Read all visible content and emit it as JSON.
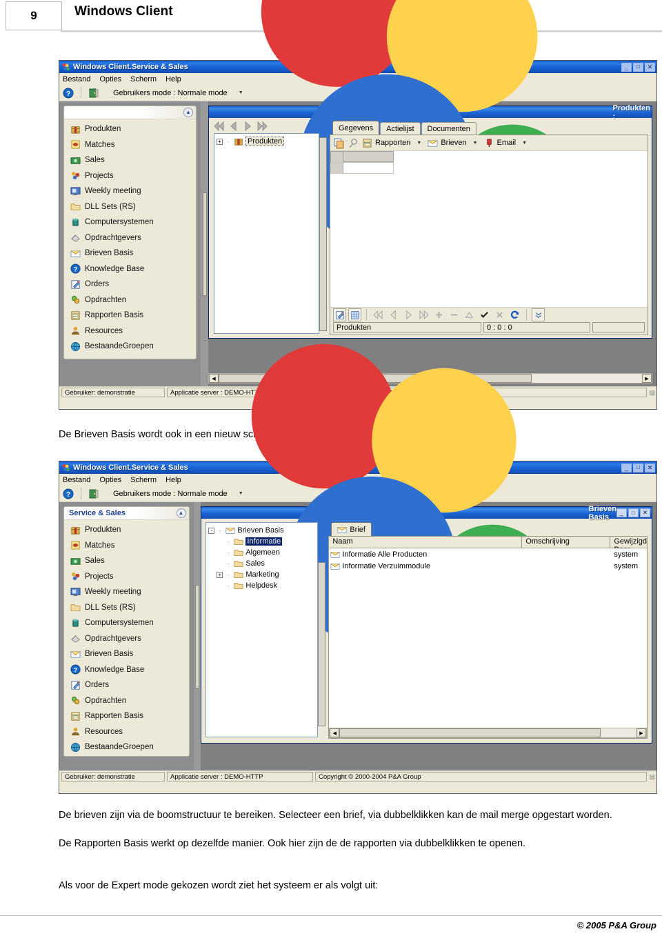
{
  "page": {
    "number": "9",
    "header_title": "Windows Client",
    "footer": "© 2005 P&A Group"
  },
  "paragraphs": {
    "between_screens": "De Brieven Basis wordt ook in een nieuw scherm geopend.",
    "p1": "De brieven zijn via de boomstructuur te bereiken. Selecteer een brief, via dubbelklikken kan de mail merge opgestart worden.",
    "p2": "De Rapporten Basis werkt op dezelfde manier. Ook hier zijn de de rapporten via dubbelklikken te openen.",
    "p3": "Als voor de Expert mode gekozen wordt ziet het systeem er als volgt uit:"
  },
  "app": {
    "title": "Windows Client.Service & Sales",
    "menus": [
      "Bestand",
      "Opties",
      "Scherm",
      "Help"
    ],
    "toolbar": {
      "help_icon": "help-question-icon",
      "exit_icon": "exit-door-icon",
      "mode_label": "Gebruikers mode : Normale mode",
      "caret": "▼"
    },
    "window_buttons": {
      "minimize": "_",
      "maximize": "□",
      "close": "✕"
    },
    "statusbar": {
      "user": "Gebruiker: demonstratie",
      "server": "Applicatie server : DEMO-HTTP",
      "copyright": "Copyright © 2000-2004 P&A Group"
    }
  },
  "nav": {
    "header_blank": "",
    "header_title": "Service & Sales",
    "collapse_icon": "chevron-up-icon",
    "items": [
      {
        "label": "Produkten",
        "icon": "gift-box-icon"
      },
      {
        "label": "Matches",
        "icon": "yellow-match-icon"
      },
      {
        "label": "Sales",
        "icon": "money-icon"
      },
      {
        "label": "Projects",
        "icon": "projects-icon"
      },
      {
        "label": "Weekly meeting",
        "icon": "meeting-icon"
      },
      {
        "label": "DLL Sets (RS)",
        "icon": "folder-icon"
      },
      {
        "label": "Computersystemen",
        "icon": "database-icon"
      },
      {
        "label": "Opdrachtgevers",
        "icon": "clients-icon"
      },
      {
        "label": "Brieven Basis",
        "icon": "envelope-icon"
      },
      {
        "label": "Knowledge Base",
        "icon": "help-question-icon"
      },
      {
        "label": "Orders",
        "icon": "edit-note-icon"
      },
      {
        "label": "Opdrachten",
        "icon": "tasks-icon"
      },
      {
        "label": "Rapporten Basis",
        "icon": "report-icon"
      },
      {
        "label": "Resources",
        "icon": "person-icon"
      },
      {
        "label": "BestaandeGroepen",
        "icon": "globe-icon"
      }
    ]
  },
  "produkten_window": {
    "title": "Produkten :",
    "nav_arrows": [
      "first",
      "previous",
      "next",
      "last"
    ],
    "tree": {
      "root_label": "Produkten",
      "expander": "+",
      "icon": "gift-box-icon"
    },
    "tabs": [
      {
        "label": "Gegevens",
        "active": true
      },
      {
        "label": "Actielijst",
        "active": false
      },
      {
        "label": "Documenten",
        "active": false
      }
    ],
    "tab_toolbar": [
      {
        "label": "",
        "icon": "copy-icon"
      },
      {
        "label": "",
        "icon": "search-key-icon"
      },
      {
        "label": "Rapporten",
        "icon": "report-icon",
        "caret": "▼"
      },
      {
        "label": "Brieven",
        "icon": "envelope-icon",
        "caret": "▼"
      },
      {
        "label": "Email",
        "icon": "email-pin-icon",
        "caret": "▼"
      }
    ],
    "record_toolbar": [
      "edit-record-icon",
      "grid-view-icon",
      "first-record-icon",
      "prev-record-icon",
      "next-record-icon",
      "last-record-icon",
      "add-record-icon",
      "delete-record-icon",
      "up-record-icon",
      "confirm-icon",
      "cancel-icon",
      "refresh-icon",
      "expand-icon"
    ],
    "record_status": {
      "name": "Produkten",
      "counter": "0 : 0 : 0",
      "extra": ""
    }
  },
  "brieven_window": {
    "title": "Brieven Basis",
    "window_buttons": {
      "minimize": "_",
      "maximize": "□",
      "close": "✕"
    },
    "tree": [
      {
        "label": "Brieven Basis",
        "icon": "envelope-icon",
        "expander": "-",
        "depth": 0,
        "selected": false
      },
      {
        "label": "Informatie",
        "icon": "folder-icon",
        "expander": "",
        "depth": 1,
        "selected": true
      },
      {
        "label": "Algemeen",
        "icon": "folder-icon",
        "expander": "",
        "depth": 1,
        "selected": false
      },
      {
        "label": "Sales",
        "icon": "folder-icon",
        "expander": "",
        "depth": 1,
        "selected": false
      },
      {
        "label": "Marketing",
        "icon": "folder-icon",
        "expander": "+",
        "depth": 1,
        "selected": false
      },
      {
        "label": "Helpdesk",
        "icon": "folder-icon",
        "expander": "",
        "depth": 1,
        "selected": false
      }
    ],
    "tabs": [
      {
        "label": "Brief",
        "icon": "envelope-icon",
        "active": true
      }
    ],
    "table": {
      "columns": [
        "Naam",
        "Omschrijving",
        "Gewijzigd Door"
      ],
      "rows": [
        {
          "naam": "Informatie Alle Producten",
          "omschrijving": "",
          "gewijzigd_door": "system",
          "icon": "envelope-icon"
        },
        {
          "naam": "Informatie Verzuimmodule",
          "omschrijving": "",
          "gewijzigd_door": "system",
          "icon": "envelope-icon"
        }
      ]
    }
  },
  "colors": {
    "titlebar_blue": "#1a63d6",
    "selection_blue": "#0a246a",
    "window_face": "#ece9d8",
    "mdi_gray": "#808080",
    "nav_header_text": "#1b3f93"
  }
}
